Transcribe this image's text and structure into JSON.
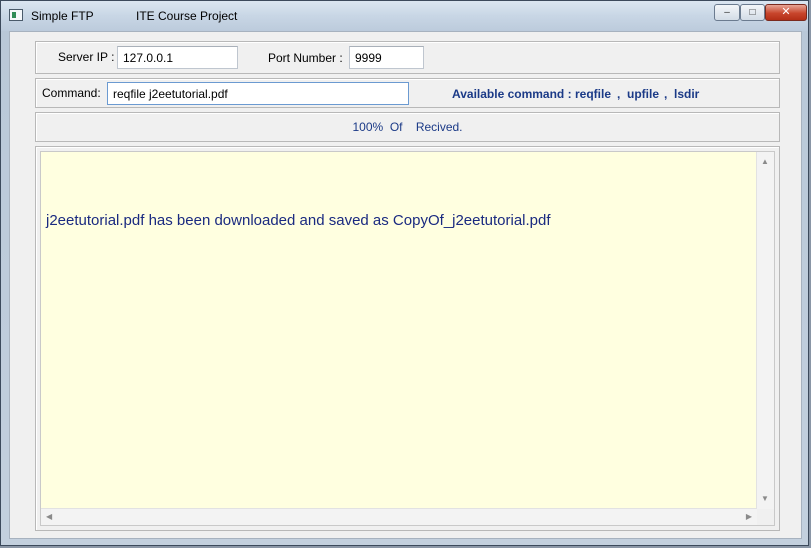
{
  "window": {
    "title": "Simple FTP",
    "subtitle": "ITE Course Project",
    "controls": {
      "minimize": "‒",
      "maximize": "□",
      "close": "✕"
    }
  },
  "connection": {
    "server_ip_label": "Server IP :",
    "server_ip_value": "127.0.0.1",
    "port_label": "Port Number :",
    "port_value": "9999"
  },
  "command": {
    "label": "Command:",
    "value": "reqfile j2eetutorial.pdf",
    "available_label": "Available command :",
    "commands": [
      "reqfile",
      "upfile",
      "lsdir"
    ],
    "separator": ","
  },
  "status": {
    "text": "100%  Of    Recived."
  },
  "output": {
    "text": "j2eetutorial.pdf has been downloaded and saved as CopyOf_j2eetutorial.pdf"
  },
  "scrollbars": {
    "up_arrow": "▲",
    "down_arrow": "▼",
    "left_arrow": "◀",
    "right_arrow": "▶"
  },
  "colors": {
    "accent_text": "#1b3a87",
    "output_background": "#ffffe0",
    "close_button": "#c8452c"
  }
}
